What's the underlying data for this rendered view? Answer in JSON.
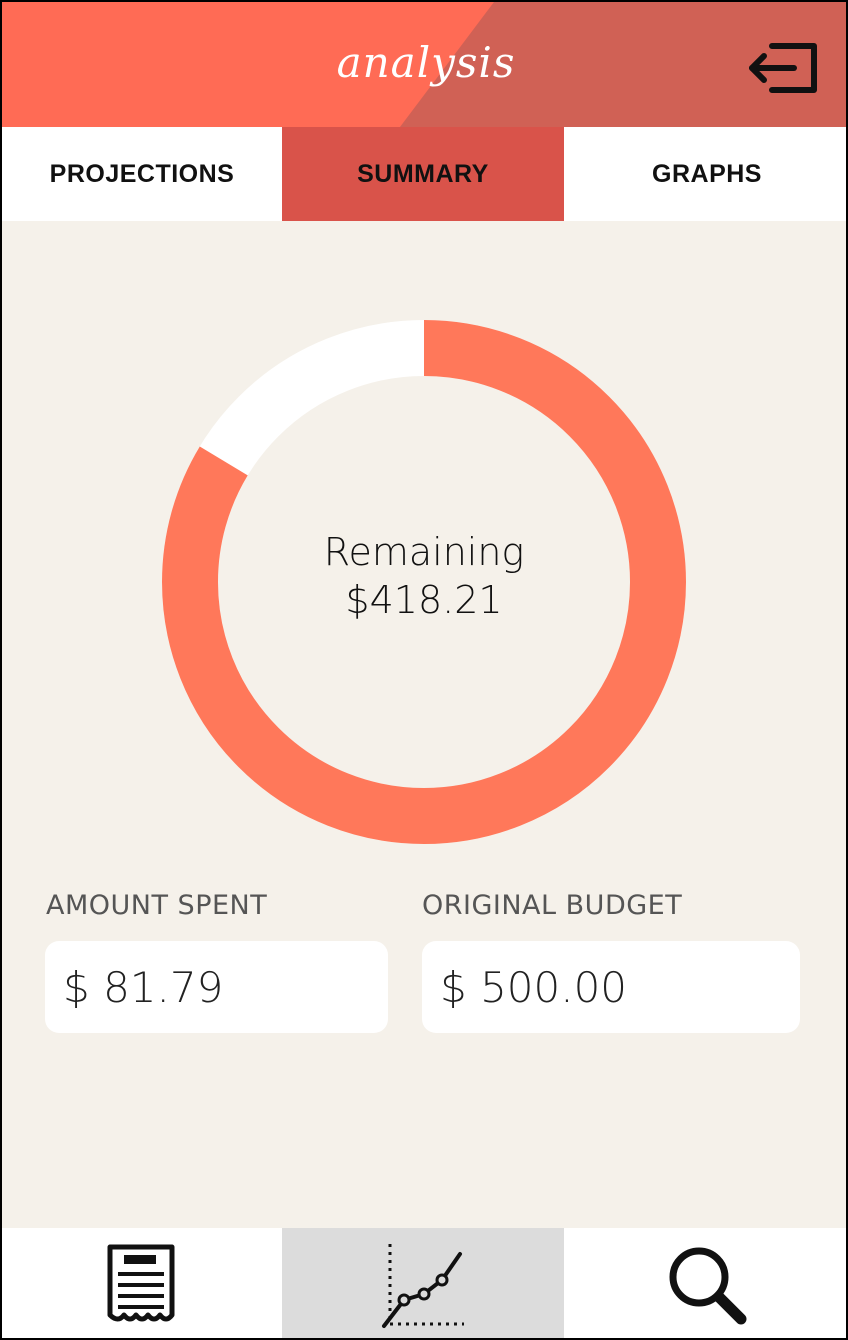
{
  "header": {
    "title": "analysis",
    "logout_icon": "logout-arrow-icon",
    "colors": {
      "left": "#ff6b55",
      "right": "#d06155"
    }
  },
  "tabs": [
    {
      "label": "PROJECTIONS",
      "active": false
    },
    {
      "label": "SUMMARY",
      "active": true
    },
    {
      "label": "GRAPHS",
      "active": false
    }
  ],
  "summary": {
    "remaining_label": "Remaining",
    "remaining_value": "$418.21",
    "spent_fraction": 0.1636,
    "ring_color": "#ff785a",
    "ring_remainder_color": "#ffffff"
  },
  "fields": {
    "amount_spent": {
      "label": "AMOUNT SPENT",
      "value": "$ 81.79"
    },
    "original_budget": {
      "label": "ORIGINAL BUDGET",
      "value": "$ 500.00"
    }
  },
  "bottom_nav": [
    {
      "icon": "receipt-icon",
      "active": false
    },
    {
      "icon": "line-graph-icon",
      "active": true
    },
    {
      "icon": "search-icon",
      "active": false
    }
  ]
}
